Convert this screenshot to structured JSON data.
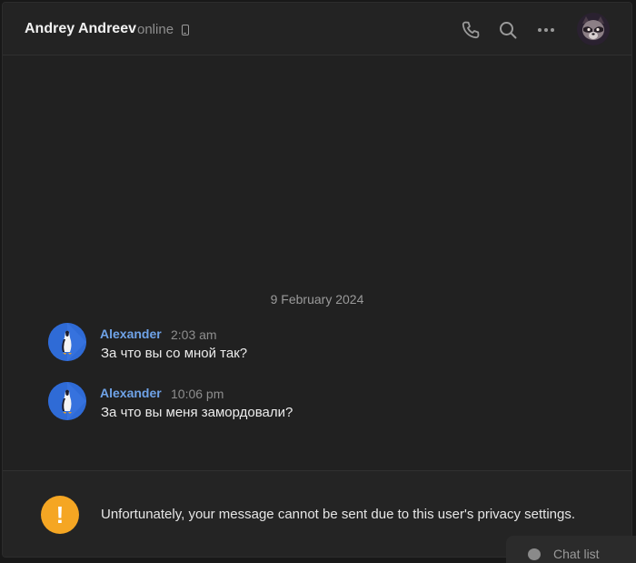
{
  "header": {
    "peer_name": "Andrey Andreev",
    "status": "online",
    "device_icon": "mobile-phone-icon",
    "actions": [
      "phone-icon",
      "search-icon",
      "more-icon"
    ]
  },
  "chat": {
    "date_separator": "9 February 2024",
    "messages": [
      {
        "author": "Alexander",
        "time": "2:03 am",
        "text": "За что вы со мной так?"
      },
      {
        "author": "Alexander",
        "time": "10:06 pm",
        "text": "За что вы меня замордовали?"
      }
    ]
  },
  "footer": {
    "warning_icon": "!",
    "notice": "Unfortunately, your message cannot be sent due to this user's privacy settings."
  },
  "chat_list": {
    "label": "Chat list"
  },
  "colors": {
    "background": "#212121",
    "author": "#6fa3e8",
    "warning": "#f5a623",
    "avatar": "#2f6bd6"
  }
}
